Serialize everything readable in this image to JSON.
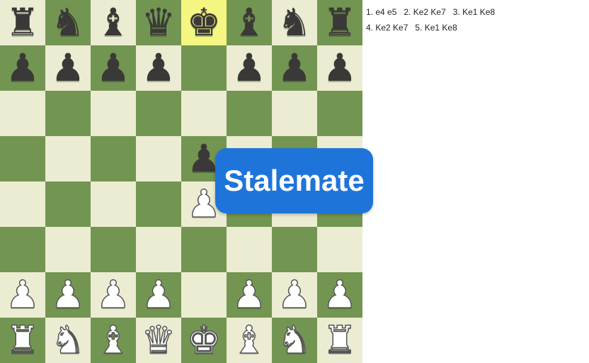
{
  "board": {
    "colors": {
      "light": "#ececd2",
      "dark": "#739552",
      "highlight": "#f5f682"
    },
    "highlighted_square": "e8",
    "rows": [
      [
        "bR",
        "bN",
        "bB",
        "bQ",
        "bK",
        "bB",
        "bN",
        "bR"
      ],
      [
        "bP",
        "bP",
        "bP",
        "bP",
        "",
        "bP",
        "bP",
        "bP"
      ],
      [
        "",
        "",
        "",
        "",
        "",
        "",
        "",
        ""
      ],
      [
        "",
        "",
        "",
        "",
        "bP",
        "",
        "",
        ""
      ],
      [
        "",
        "",
        "",
        "",
        "wP",
        "",
        "",
        ""
      ],
      [
        "",
        "",
        "",
        "",
        "",
        "",
        "",
        ""
      ],
      [
        "wP",
        "wP",
        "wP",
        "wP",
        "",
        "wP",
        "wP",
        "wP"
      ],
      [
        "wR",
        "wN",
        "wB",
        "wQ",
        "wK",
        "wB",
        "wN",
        "wR"
      ]
    ]
  },
  "move_list": [
    [
      "1. e4 e5",
      "2. Ke2 Ke7",
      "3. Ke1 Ke8"
    ],
    [
      "4. Ke2 Ke7",
      "5. Ke1 Ke8"
    ]
  ],
  "banner": {
    "text": "Stalemate",
    "color": "#1f74d9"
  }
}
